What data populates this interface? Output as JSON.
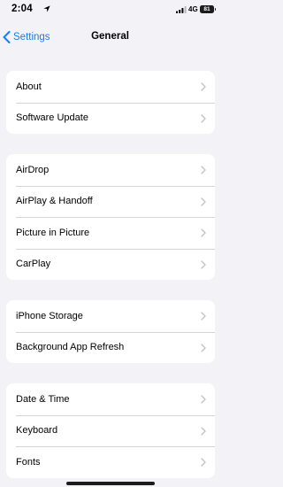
{
  "status_bar": {
    "time": "2:04",
    "network": "4G",
    "battery": "81"
  },
  "nav": {
    "back_label": "Settings",
    "title": "General"
  },
  "groups": [
    {
      "items": [
        {
          "label": "About"
        },
        {
          "label": "Software Update"
        }
      ]
    },
    {
      "items": [
        {
          "label": "AirDrop"
        },
        {
          "label": "AirPlay & Handoff"
        },
        {
          "label": "Picture in Picture"
        },
        {
          "label": "CarPlay"
        }
      ]
    },
    {
      "items": [
        {
          "label": "iPhone Storage"
        },
        {
          "label": "Background App Refresh"
        }
      ]
    },
    {
      "items": [
        {
          "label": "Date & Time"
        },
        {
          "label": "Keyboard"
        },
        {
          "label": "Fonts"
        }
      ]
    }
  ],
  "colors": {
    "accent": "#147efb",
    "background": "#f2f2f7"
  }
}
